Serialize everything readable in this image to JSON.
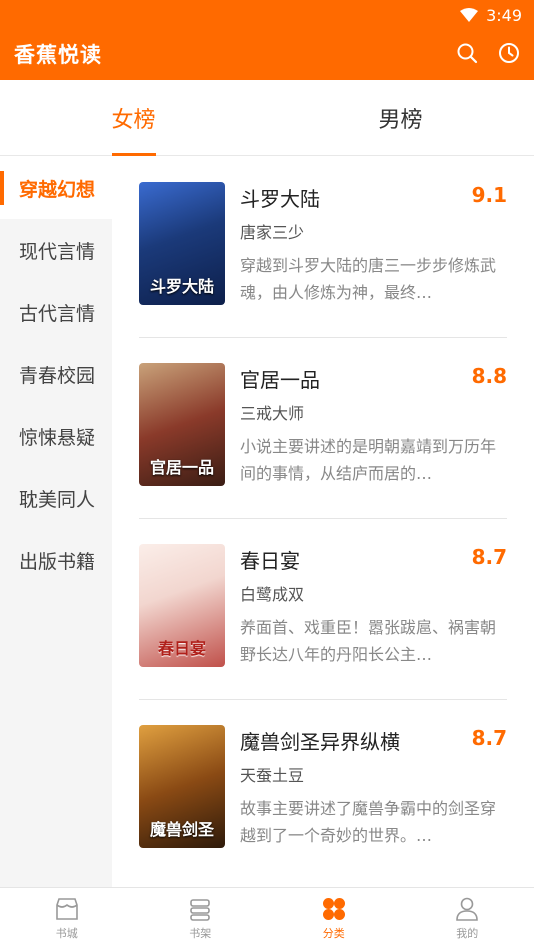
{
  "status": {
    "time": "3:49"
  },
  "header": {
    "title": "香蕉悦读",
    "icons": [
      "search-icon",
      "history-icon"
    ]
  },
  "tabs": [
    {
      "label": "女榜",
      "active": true
    },
    {
      "label": "男榜",
      "active": false
    }
  ],
  "sidebar": {
    "items": [
      {
        "label": "穿越幻想",
        "active": true
      },
      {
        "label": "现代言情"
      },
      {
        "label": "古代言情"
      },
      {
        "label": "青春校园"
      },
      {
        "label": "惊悚悬疑"
      },
      {
        "label": "耽美同人"
      },
      {
        "label": "出版书籍"
      }
    ]
  },
  "books": [
    {
      "title": "斗罗大陆",
      "score": "9.1",
      "author": "唐家三少",
      "desc": "穿越到斗罗大陆的唐三一步步修炼武魂，由人修炼为神，最终…",
      "cover_text": "斗罗大陆",
      "cover_colors": [
        "#1b3a7a",
        "#0d1f4a"
      ]
    },
    {
      "title": "官居一品",
      "score": "8.8",
      "author": "三戒大师",
      "desc": "小说主要讲述的是明朝嘉靖到万历年间的事情，从结庐而居的…",
      "cover_text": "官居一品",
      "cover_colors": [
        "#8a3a2a",
        "#3a1d14"
      ]
    },
    {
      "title": "春日宴",
      "score": "8.7",
      "author": "白鹭成双",
      "desc": "养面首、戏重臣！嚣张跋扈、祸害朝野长达八年的丹阳长公主…",
      "cover_text": "春日宴",
      "cover_colors": [
        "#f2d6cf",
        "#c0504a"
      ]
    },
    {
      "title": "魔兽剑圣异界纵横",
      "score": "8.7",
      "author": "天蚕土豆",
      "desc": "故事主要讲述了魔兽争霸中的剑圣穿越到了一个奇妙的世界。…",
      "cover_text": "魔兽剑圣",
      "cover_colors": [
        "#8a4a14",
        "#2e1a0a"
      ]
    }
  ],
  "bottom_nav": [
    {
      "label": "书城",
      "icon": "store-icon"
    },
    {
      "label": "书架",
      "icon": "shelf-icon"
    },
    {
      "label": "分类",
      "icon": "category-icon",
      "active": true
    },
    {
      "label": "我的",
      "icon": "profile-icon"
    }
  ],
  "colors": {
    "accent": "#FF6A00"
  }
}
